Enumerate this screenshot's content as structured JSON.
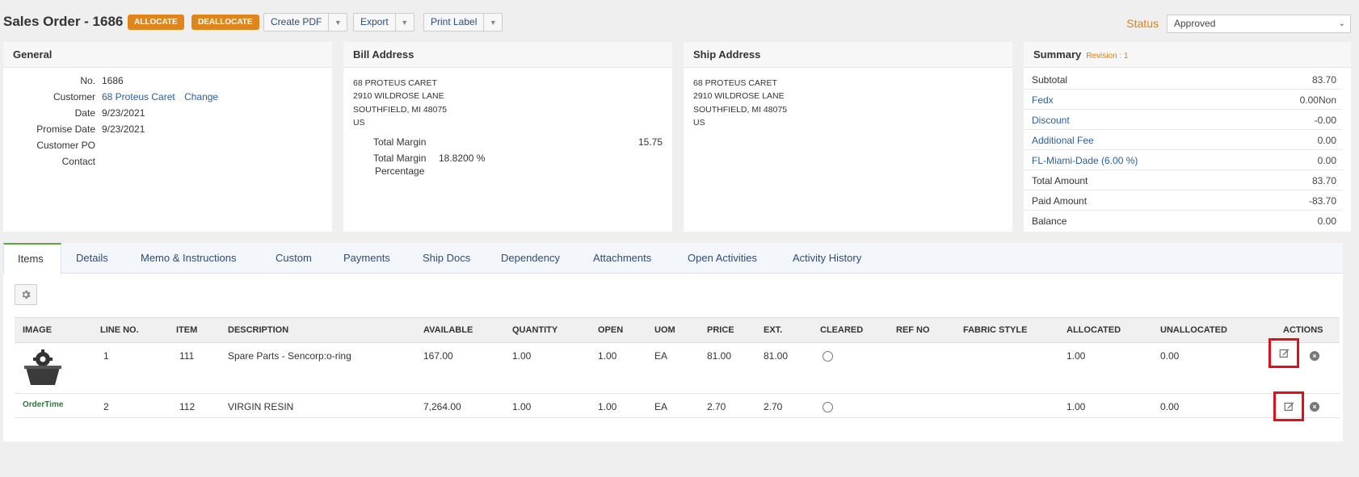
{
  "header": {
    "title": "Sales Order - 1686",
    "allocate_label": "ALLOCATE",
    "deallocate_label": "DEALLOCATE",
    "create_pdf_label": "Create PDF",
    "export_label": "Export",
    "print_label_label": "Print Label",
    "status_label": "Status",
    "status_value": "Approved"
  },
  "general": {
    "heading": "General",
    "no_label": "No.",
    "no_value": "1686",
    "customer_label": "Customer",
    "customer_value": "68 Proteus Caret",
    "change_label": "Change",
    "date_label": "Date",
    "date_value": "9/23/2021",
    "promise_label": "Promise Date",
    "promise_value": "9/23/2021",
    "customer_po_label": "Customer PO",
    "customer_po_value": "",
    "contact_label": "Contact",
    "contact_value": ""
  },
  "bill": {
    "heading": "Bill Address",
    "line1": "68 PROTEUS CARET",
    "line2": "2910 WILDROSE LANE",
    "line3": "SOUTHFIELD, MI 48075",
    "line4": "US",
    "total_margin_label": "Total Margin",
    "total_margin_value": "15.75",
    "margin_pct_label_1": "Total Margin",
    "margin_pct_label_2": "Percentage",
    "margin_pct_value": "18.8200 %"
  },
  "ship": {
    "heading": "Ship Address",
    "line1": "68 PROTEUS CARET",
    "line2": "2910 WILDROSE LANE",
    "line3": "SOUTHFIELD, MI 48075",
    "line4": "US"
  },
  "summary": {
    "heading": "Summary",
    "revision": "Revision : 1",
    "rows": [
      {
        "label": "Subtotal",
        "value": "83.70"
      },
      {
        "label": "Fedx",
        "value": "0.00Non"
      },
      {
        "label": "Discount",
        "value": "-0.00"
      },
      {
        "label": "Additional Fee",
        "value": "0.00"
      },
      {
        "label": "FL-Miami-Dade (6.00 %)",
        "value": "0.00"
      },
      {
        "label": "Total Amount",
        "value": "83.70"
      },
      {
        "label": "Paid Amount",
        "value": "-83.70"
      },
      {
        "label": "Balance",
        "value": "0.00"
      }
    ]
  },
  "tabs": [
    {
      "label": "Items"
    },
    {
      "label": "Details"
    },
    {
      "label": "Memo & Instructions"
    },
    {
      "label": "Custom"
    },
    {
      "label": "Payments"
    },
    {
      "label": "Ship Docs"
    },
    {
      "label": "Dependency"
    },
    {
      "label": "Attachments"
    },
    {
      "label": "Open Activities"
    },
    {
      "label": "Activity History"
    }
  ],
  "items_table": {
    "columns": [
      "IMAGE",
      "LINE NO.",
      "ITEM",
      "DESCRIPTION",
      "AVAILABLE",
      "QUANTITY",
      "OPEN",
      "UOM",
      "PRICE",
      "EXT.",
      "CLEARED",
      "REF NO",
      "FABRIC STYLE",
      "ALLOCATED",
      "UNALLOCATED",
      "ACTIONS"
    ],
    "rows": [
      {
        "image": "gear-basket",
        "line": "1",
        "item": "111",
        "description": "Spare Parts - Sencorp:o-ring",
        "available": "167.00",
        "quantity": "1.00",
        "open": "1.00",
        "uom": "EA",
        "price": "81.00",
        "ext": "81.00",
        "ref_no": "",
        "fabric_style": "",
        "allocated": "1.00",
        "unallocated": "0.00"
      },
      {
        "image": "ordertime-logo",
        "logo_text": "OrderTime",
        "line": "2",
        "item": "112",
        "description": "VIRGIN RESIN",
        "available": "7,264.00",
        "quantity": "1.00",
        "open": "1.00",
        "uom": "EA",
        "price": "2.70",
        "ext": "2.70",
        "ref_no": "",
        "fabric_style": "",
        "allocated": "1.00",
        "unallocated": "0.00"
      }
    ]
  },
  "colors": {
    "accent_orange": "#e0851b",
    "link_blue": "#2a5d9a",
    "highlight_red": "#e0111d",
    "active_tab_green": "#59a83a"
  }
}
